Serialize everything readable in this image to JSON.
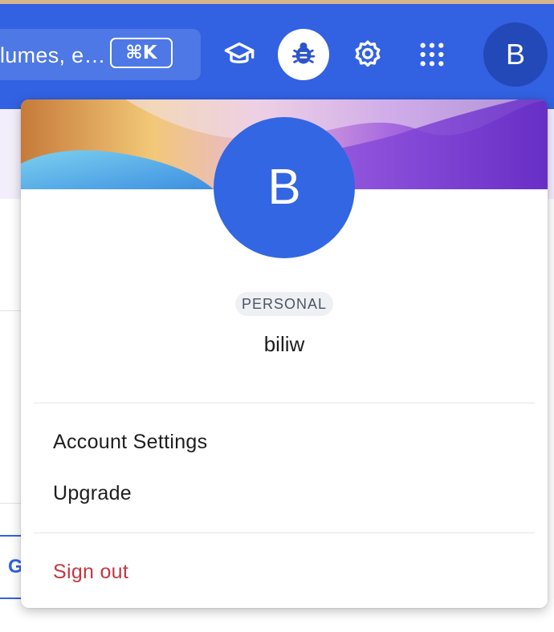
{
  "topbar": {
    "search": {
      "text": "lumes, e…",
      "shortcut": "⌘K"
    },
    "icons": [
      "graduation-cap-icon",
      "bug-icon",
      "gear-icon",
      "apps-grid-icon"
    ],
    "avatar_letter": "B",
    "colors": {
      "bar": "#3261e2",
      "search": "#4d78e6",
      "avatar": "#2348b8"
    }
  },
  "background": {
    "tab_letter": "G"
  },
  "account_menu": {
    "avatar_letter": "B",
    "plan_badge": "PERSONAL",
    "username": "biliw",
    "items": [
      {
        "label": "Account Settings"
      },
      {
        "label": "Upgrade"
      }
    ],
    "sign_out": "Sign out",
    "colors": {
      "avatar": "#3366e3",
      "sign_out": "#c5373f"
    }
  }
}
